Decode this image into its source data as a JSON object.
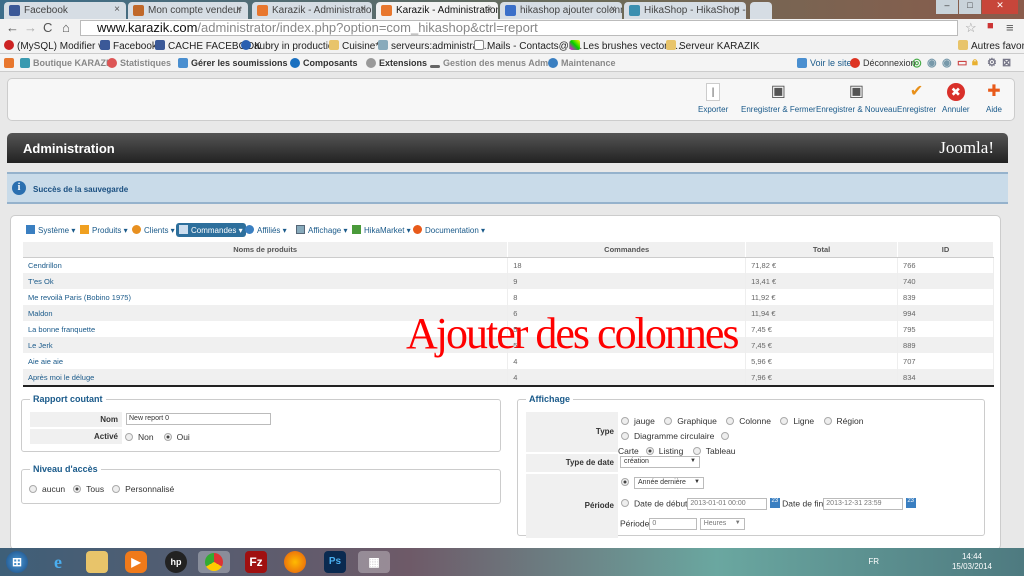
{
  "browser": {
    "tabs": [
      {
        "title": "Facebook",
        "color": "#3b5998"
      },
      {
        "title": "Mon compte vendeur",
        "color": "#c0682a"
      },
      {
        "title": "Karazik - Administration -",
        "color": "#e8772e"
      },
      {
        "title": "Karazik - Administration -",
        "color": "#e8772e",
        "active": true
      },
      {
        "title": "hikashop ajouter colonne",
        "color": "#3a6fc9"
      },
      {
        "title": "HikaShop - HikaShop - N",
        "color": "#3b8fb0"
      }
    ],
    "url_domain": "www.karazik.com",
    "url_path": "/administrator/index.php?option=com_hikashop&ctrl=report",
    "bookmarks": [
      "(MySQL) Modifier v...",
      "Facebook",
      "CACHE FACEBOOK",
      "aubry in production",
      "Cuisine*",
      "serveurs:administrat...",
      "Mails - Contacts@k...",
      "Les brushes vectors ...",
      "Serveur KARAZIK"
    ],
    "other_bookmarks": "Autres favoris"
  },
  "admin_menu": {
    "items": [
      "Boutique KARAZIK",
      "Statistiques",
      "Gérer les soumissions",
      "Composants",
      "Extensions",
      "Gestion des menus Admin",
      "Maintenance"
    ],
    "view_site": "Voir le site",
    "logout": "Déconnexion"
  },
  "toolbar": {
    "export": "Exporter",
    "save_close": "Enregistrer & Fermer",
    "save_new": "Enregistrer & Nouveau",
    "save": "Enregistrer",
    "cancel": "Annuler",
    "help": "Aide"
  },
  "header": {
    "title": "Administration",
    "logo": "Joomla!"
  },
  "message": "Succès de la sauvegarde",
  "hika_menu": [
    "Système",
    "Produits",
    "Clients",
    "Commandes",
    "Affiliés",
    "Affichage",
    "HikaMarket",
    "Documentation"
  ],
  "table": {
    "headers": [
      "Noms de produits",
      "Commandes",
      "Total",
      "ID"
    ],
    "rows": [
      [
        "Cendrillon",
        "18",
        "71,82 €",
        "766"
      ],
      [
        "T'es Ok",
        "9",
        "13,41 €",
        "740"
      ],
      [
        "Me revoilà Paris (Bobino 1975)",
        "8",
        "11,92 €",
        "839"
      ],
      [
        "Maldon",
        "6",
        "11,94 €",
        "994"
      ],
      [
        "La bonne franquette",
        "5",
        "7,45 €",
        "795"
      ],
      [
        "Le Jerk",
        "5",
        "7,45 €",
        "889"
      ],
      [
        "Aie aie aie",
        "4",
        "5,96 €",
        "707"
      ],
      [
        "Après moi le déluge",
        "4",
        "7,96 €",
        "834"
      ]
    ]
  },
  "overlay_text": "Ajouter des colonnes",
  "rapport": {
    "legend": "Rapport coutant",
    "name_label": "Nom",
    "name_value": "New report 0",
    "active_label": "Activé",
    "no": "Non",
    "yes": "Oui"
  },
  "access": {
    "legend": "Niveau d'accès",
    "options": [
      "aucun",
      "Tous",
      "Personnalisé"
    ]
  },
  "display": {
    "legend": "Affichage",
    "type_label": "Type",
    "types": [
      "jauge",
      "Graphique",
      "Colonne",
      "Ligne",
      "Région",
      "Diagramme circulaire",
      "Carte",
      "Listing",
      "Tableau"
    ],
    "date_type_label": "Type de date",
    "date_type_value": "création",
    "period_label": "Période",
    "period_select": "Année dernière",
    "start_label": "Date de début",
    "start_value": "2013-01-01 00:00",
    "end_label": "Date de fin",
    "end_value": "2013-12-31 23:59",
    "period_field_label": "Période",
    "period_value": "0",
    "period_unit": "Heures"
  },
  "taskbar": {
    "lang": "FR",
    "time": "14:44",
    "date": "15/03/2014"
  }
}
